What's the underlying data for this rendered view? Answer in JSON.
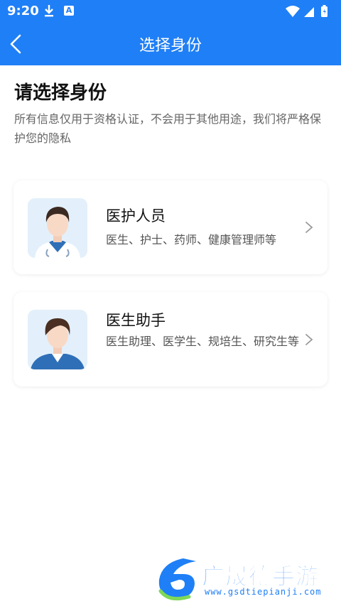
{
  "status": {
    "time": "9:20"
  },
  "nav": {
    "title": "选择身份"
  },
  "page": {
    "heading": "请选择身份",
    "description": "所有信息仅用于资格认证，不会用于其他用途，我们将严格保护您的隐私"
  },
  "roles": [
    {
      "title": "医护人员",
      "subtitle": "医生、护士、药师、健康管理师等"
    },
    {
      "title": "医生助手",
      "subtitle": "医生助理、医学生、规培生、研究生等"
    }
  ],
  "watermark": {
    "brand": "广晟德手游",
    "url": "www.gsdtiepianji.com"
  },
  "colors": {
    "primary": "#1f7ff6",
    "avatar_bg": "#e3f0fb"
  }
}
